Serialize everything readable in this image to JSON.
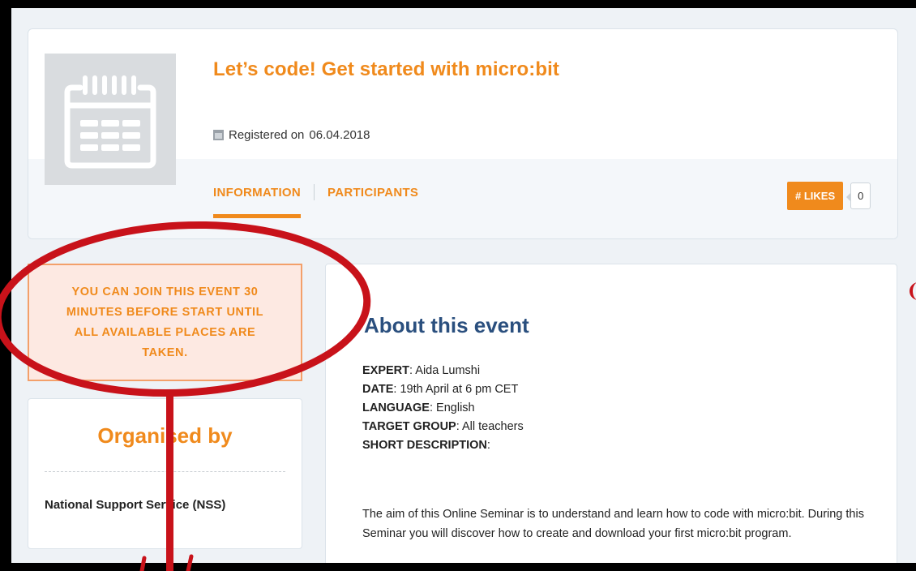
{
  "event": {
    "title": "Let’s code! Get started with micro:bit",
    "registered_label": "Registered on",
    "registered_date": "06.04.2018"
  },
  "tabs": [
    {
      "label": "INFORMATION",
      "active": true
    },
    {
      "label": "PARTICIPANTS",
      "active": false
    }
  ],
  "likes": {
    "label": "# LIKES",
    "count": "0"
  },
  "notice": "YOU CAN JOIN THIS EVENT 30 MINUTES BEFORE START UNTIL ALL AVAILABLE PLACES ARE TAKEN.",
  "organiser": {
    "heading": "Organised by",
    "name": "National Support Service (NSS)"
  },
  "about": {
    "heading": "About this event",
    "fields": [
      {
        "label": "EXPERT",
        "value": "Aida Lumshi"
      },
      {
        "label": "DATE",
        "value": "19th April at 6 pm CET"
      },
      {
        "label": "LANGUAGE",
        "value": "English"
      },
      {
        "label": "TARGET GROUP",
        "value": "All teachers"
      },
      {
        "label": "SHORT DESCRIPTION",
        "value": ""
      }
    ],
    "description": "The aim of this Online Seminar is to understand and learn how to code with micro:bit. During this Seminar you will discover how to create and download your first micro:bit program."
  },
  "colors": {
    "accent": "#f08a1c",
    "heading_blue": "#2a4f7e",
    "notice_bg": "#fde9e2",
    "annotation_red": "#c8121a"
  },
  "icons": {
    "thumbnail": "calendar-icon",
    "registered": "calendar-small-icon"
  }
}
